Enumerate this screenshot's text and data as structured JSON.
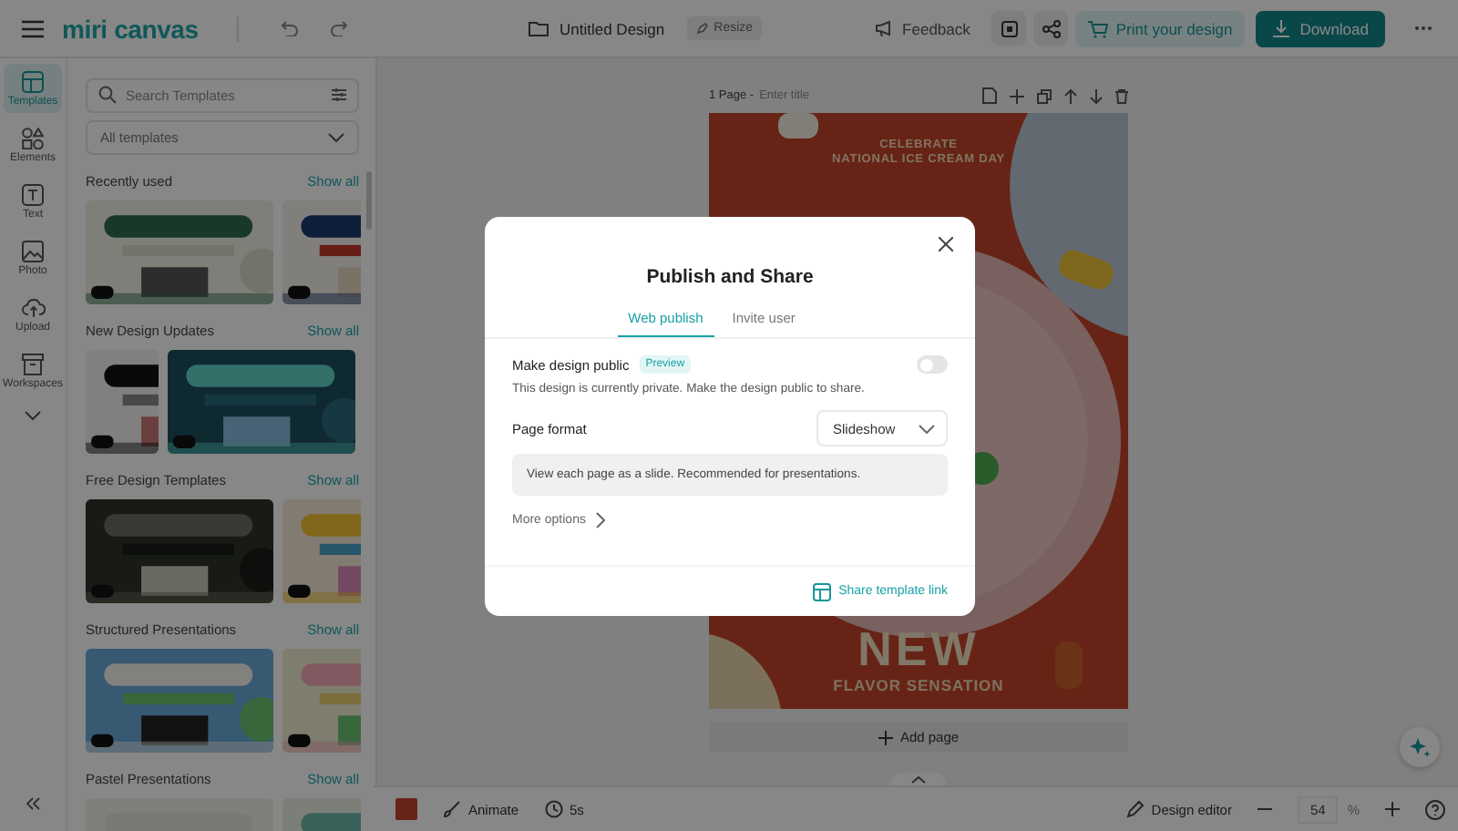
{
  "topbar": {
    "logo": "miri canvas",
    "doc_title": "Untitled Design",
    "resize": "Resize",
    "feedback": "Feedback",
    "print": "Print your design",
    "download": "Download"
  },
  "rail": [
    {
      "kind": "templates",
      "label": "Templates",
      "selected": true
    },
    {
      "kind": "elements",
      "label": "Elements",
      "selected": false
    },
    {
      "kind": "text",
      "label": "Text",
      "selected": false
    },
    {
      "label": "Photo",
      "selected": false
    },
    {
      "kind": "upload",
      "label": "Upload",
      "selected": false
    },
    {
      "kind": "workspaces",
      "label": "Workspaces",
      "selected": false
    }
  ],
  "panel": {
    "search_placeholder": "Search Templates",
    "filter": "All templates",
    "sections": [
      {
        "title": "Recently used",
        "show_all": "Show all"
      },
      {
        "title": "New Design Updates",
        "show_all": "Show all"
      },
      {
        "title": "Free Design Templates",
        "show_all": "Show all"
      },
      {
        "title": "Structured Presentations",
        "show_all": "Show all"
      },
      {
        "title": "Pastel Presentations",
        "show_all": "Show all"
      }
    ]
  },
  "page": {
    "label": "1 Page -",
    "title_placeholder": "Enter title",
    "add_page": "Add page"
  },
  "poster": {
    "line1": "CELEBRATE",
    "line2": "NATIONAL ICE CREAM DAY",
    "headline": "NEW",
    "tagline": "FLAVOR SENSATION"
  },
  "bottombar": {
    "animate": "Animate",
    "duration": "5s",
    "design_editor": "Design editor",
    "zoom": "54",
    "zoom_unit": "%"
  },
  "dialog": {
    "title": "Publish and Share",
    "tabs": [
      {
        "label": "Web publish",
        "selected": true
      },
      {
        "label": "Invite user",
        "selected": false
      }
    ],
    "public_label": "Make design public",
    "public_badge": "Preview",
    "public_on": false,
    "public_hint": "This design is currently private. Make the design public to share.",
    "format_label": "Page format",
    "format_value": "Slideshow",
    "format_info": "View each page as a slide. Recommended for presentations.",
    "more_options": "More options",
    "share_link": "Share template link"
  }
}
